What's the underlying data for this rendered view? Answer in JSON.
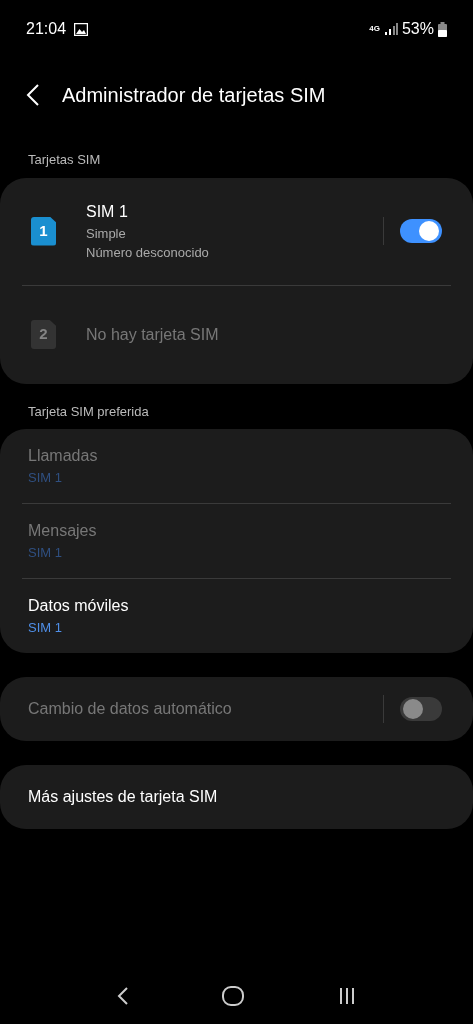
{
  "status_bar": {
    "time": "21:04",
    "network": "4G",
    "battery": "53%"
  },
  "header": {
    "title": "Administrador de tarjetas SIM"
  },
  "sim_section": {
    "label": "Tarjetas SIM",
    "sims": [
      {
        "number": "1",
        "name": "SIM 1",
        "lines": [
          "Simple",
          "Número desconocido"
        ],
        "disabled": false,
        "toggle": {
          "on": true
        }
      },
      {
        "number": "2",
        "name": "No hay tarjeta SIM",
        "disabled": true
      }
    ]
  },
  "preferred_section": {
    "label": "Tarjeta SIM preferida",
    "items": [
      {
        "title": "Llamadas",
        "value": "SIM 1",
        "disabled": true
      },
      {
        "title": "Mensajes",
        "value": "SIM 1",
        "disabled": true
      },
      {
        "title": "Datos móviles",
        "value": "SIM 1",
        "disabled": false
      }
    ]
  },
  "auto_switch": {
    "label": "Cambio de datos automático",
    "disabled": true,
    "on": false
  },
  "more": {
    "label": "Más ajustes de tarjeta SIM"
  }
}
